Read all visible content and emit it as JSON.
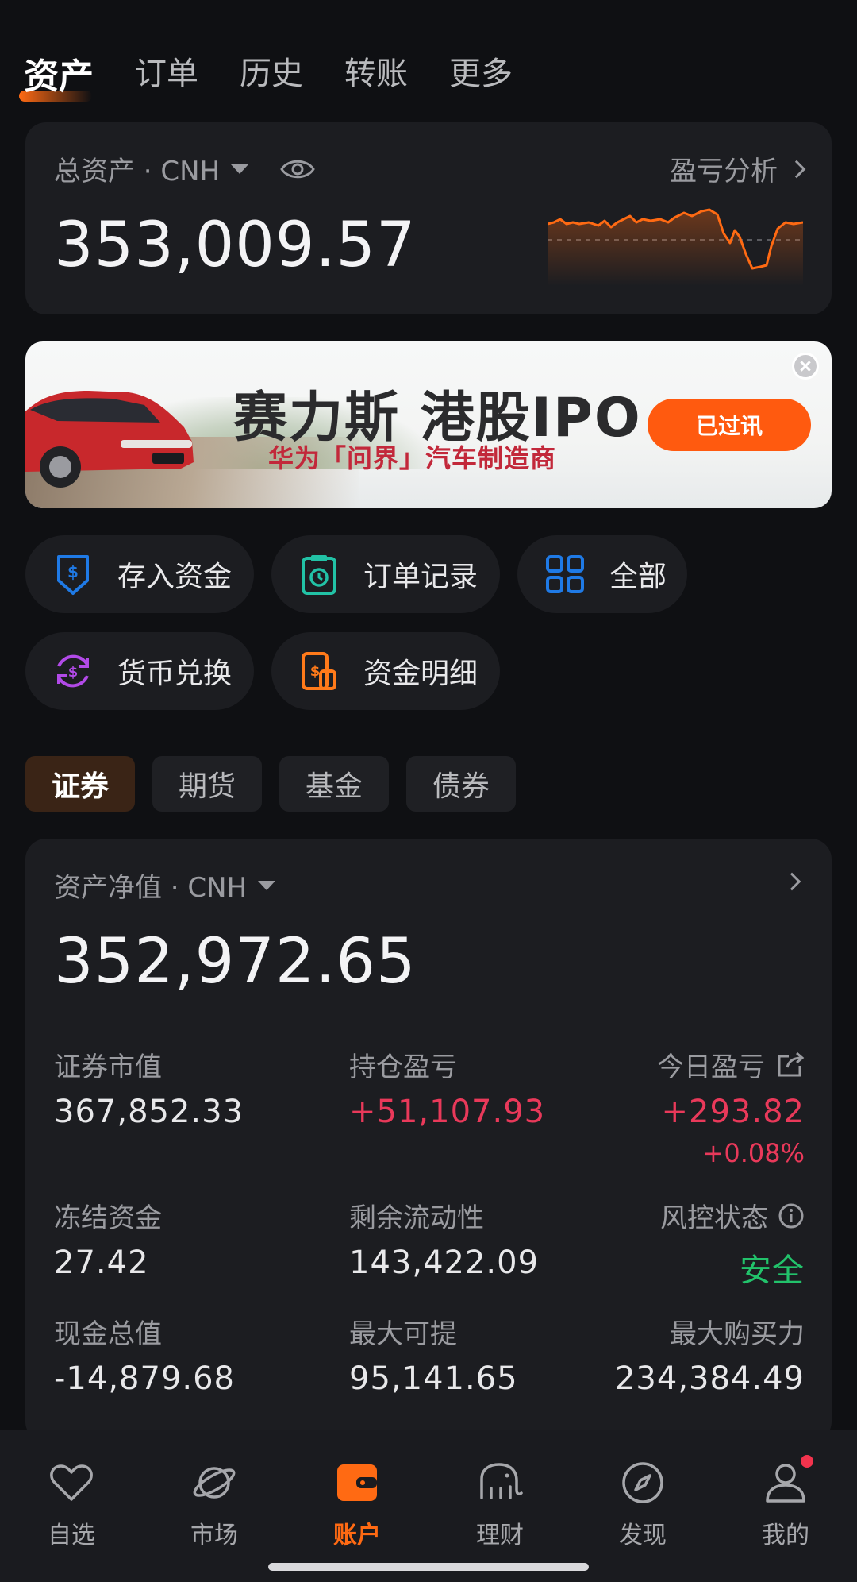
{
  "top_tabs": [
    "资产",
    "订单",
    "历史",
    "转账",
    "更多"
  ],
  "assets": {
    "label": "总资产 · CNH",
    "value": "353,009.57",
    "pnl_link": "盈亏分析"
  },
  "banner": {
    "title": "赛力斯 港股IPO",
    "subtitle": "华为「问界」汽车制造商",
    "button": "已过讯"
  },
  "quick_actions": [
    {
      "label": "存入资金",
      "icon": "deposit-icon",
      "color": "#1f7ae6"
    },
    {
      "label": "订单记录",
      "icon": "clipboard-clock-icon",
      "color": "#22c2a6"
    },
    {
      "label": "全部",
      "icon": "grid-icon",
      "color": "#1f7ae6"
    },
    {
      "label": "货币兑换",
      "icon": "currency-exchange-icon",
      "color": "#b24ae8"
    },
    {
      "label": "资金明细",
      "icon": "fund-detail-icon",
      "color": "#ff7a1a"
    }
  ],
  "account_tabs": [
    "证券",
    "期货",
    "基金",
    "债券"
  ],
  "net": {
    "label": "资产净值 · CNH",
    "value": "352,972.65",
    "metrics": {
      "market_value": {
        "label": "证券市值",
        "value": "367,852.33"
      },
      "position_pnl": {
        "label": "持仓盈亏",
        "value": "+51,107.93"
      },
      "today_pnl": {
        "label": "今日盈亏",
        "value": "+293.82",
        "pct": "+0.08%"
      },
      "frozen": {
        "label": "冻结资金",
        "value": "27.42"
      },
      "liquidity": {
        "label": "剩余流动性",
        "value": "143,422.09"
      },
      "risk": {
        "label": "风控状态",
        "value": "安全"
      },
      "cash": {
        "label": "现金总值",
        "value": "-14,879.68"
      },
      "max_withdraw": {
        "label": "最大可提",
        "value": "95,141.65"
      },
      "max_buying": {
        "label": "最大购买力",
        "value": "234,384.49"
      }
    }
  },
  "bottom_nav": [
    "自选",
    "市场",
    "账户",
    "理财",
    "发现",
    "我的"
  ],
  "colors": {
    "accent": "#ff6a13",
    "up": "#e9395a",
    "safe": "#22c26b"
  }
}
